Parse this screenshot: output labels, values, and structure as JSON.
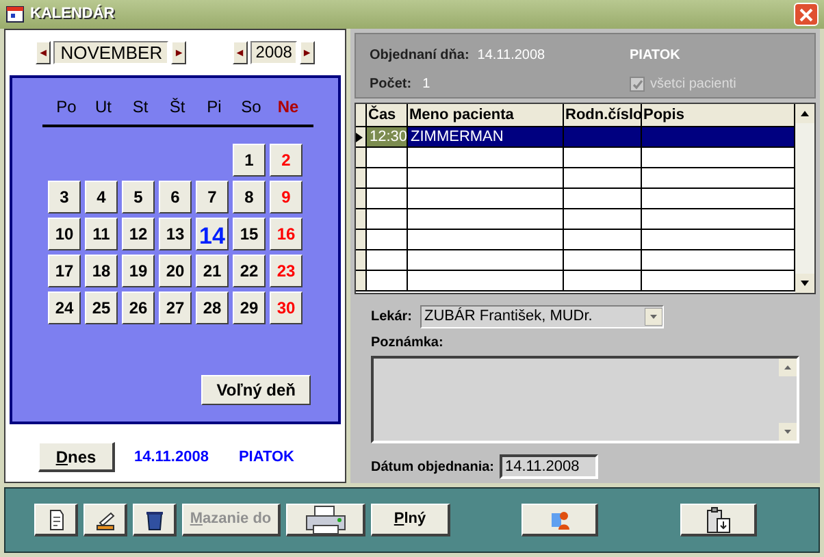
{
  "window": {
    "title": "KALENDÁR"
  },
  "month_selector": {
    "value": "NOVEMBER",
    "prev": "◄",
    "next": "►"
  },
  "year_selector": {
    "value": "2008",
    "prev": "◄",
    "next": "►"
  },
  "weekdays": [
    {
      "label": "Po",
      "kind": "weekday"
    },
    {
      "label": "Ut",
      "kind": "weekday"
    },
    {
      "label": "St",
      "kind": "weekday"
    },
    {
      "label": "Št",
      "kind": "weekday"
    },
    {
      "label": "Pi",
      "kind": "weekday"
    },
    {
      "label": "So",
      "kind": "weekday"
    },
    {
      "label": "Ne",
      "kind": "sunday"
    }
  ],
  "weeks": [
    [
      {
        "kind": "blank"
      },
      {
        "kind": "blank"
      },
      {
        "kind": "blank"
      },
      {
        "kind": "blank"
      },
      {
        "kind": "blank"
      },
      {
        "label": "1",
        "kind": "day",
        "selected": false
      },
      {
        "label": "2",
        "kind": "sunday",
        "selected": false
      }
    ],
    [
      {
        "label": "3",
        "kind": "day",
        "selected": false
      },
      {
        "label": "4",
        "kind": "day",
        "selected": false
      },
      {
        "label": "5",
        "kind": "day",
        "selected": false
      },
      {
        "label": "6",
        "kind": "day",
        "selected": false
      },
      {
        "label": "7",
        "kind": "day",
        "selected": false
      },
      {
        "label": "8",
        "kind": "day",
        "selected": false
      },
      {
        "label": "9",
        "kind": "sunday",
        "selected": false
      }
    ],
    [
      {
        "label": "10",
        "kind": "day",
        "selected": false
      },
      {
        "label": "11",
        "kind": "day",
        "selected": false
      },
      {
        "label": "12",
        "kind": "day",
        "selected": false
      },
      {
        "label": "13",
        "kind": "day",
        "selected": false
      },
      {
        "label": "14",
        "kind": "day",
        "selected": true
      },
      {
        "label": "15",
        "kind": "day",
        "selected": false
      },
      {
        "label": "16",
        "kind": "sunday",
        "selected": false
      }
    ],
    [
      {
        "label": "17",
        "kind": "day",
        "selected": false
      },
      {
        "label": "18",
        "kind": "day",
        "selected": false
      },
      {
        "label": "19",
        "kind": "day",
        "selected": false
      },
      {
        "label": "20",
        "kind": "day",
        "selected": false
      },
      {
        "label": "21",
        "kind": "day",
        "selected": false
      },
      {
        "label": "22",
        "kind": "day",
        "selected": false
      },
      {
        "label": "23",
        "kind": "sunday",
        "selected": false
      }
    ],
    [
      {
        "label": "24",
        "kind": "day",
        "selected": false
      },
      {
        "label": "25",
        "kind": "day",
        "selected": false
      },
      {
        "label": "26",
        "kind": "day",
        "selected": false
      },
      {
        "label": "27",
        "kind": "day",
        "selected": false
      },
      {
        "label": "28",
        "kind": "day",
        "selected": false
      },
      {
        "label": "29",
        "kind": "day",
        "selected": false
      },
      {
        "label": "30",
        "kind": "sunday",
        "selected": false
      }
    ]
  ],
  "free_day_button": "Voľný deň",
  "today": {
    "button": "Dnes",
    "date": "14.11.2008",
    "weekday": "PIATOK"
  },
  "header": {
    "ordered_label": "Objednaní dňa:",
    "ordered_date": "14.11.2008",
    "weekday": "PIATOK",
    "count_label": "Počet:",
    "count": "1",
    "all_patients": {
      "label": "všetci pacienti",
      "checked": true,
      "disabled": true
    }
  },
  "table": {
    "columns": [
      "Čas",
      "Meno pacienta",
      "Rodn.číslo",
      "Popis"
    ],
    "rows": [
      {
        "cells": [
          "12:30",
          "ZIMMERMAN"
        ],
        "selected": true
      }
    ]
  },
  "doctor": {
    "label": "Lekár:",
    "value": "ZUBÁR František, MUDr."
  },
  "note": {
    "label": "Poznámka:"
  },
  "order_date": {
    "label": "Dátum objednania:",
    "value": "14.11.2008"
  },
  "toolbar": [
    {
      "kind": "icon"
    },
    {
      "kind": "icon"
    },
    {
      "kind": "icon"
    },
    {
      "kind": "text",
      "label": "Mazanie do",
      "disabled": true
    },
    {
      "kind": "icon"
    },
    {
      "kind": "text",
      "label": "Plný",
      "disabled": false
    },
    {
      "kind": "icon"
    },
    {
      "kind": "icon"
    }
  ]
}
